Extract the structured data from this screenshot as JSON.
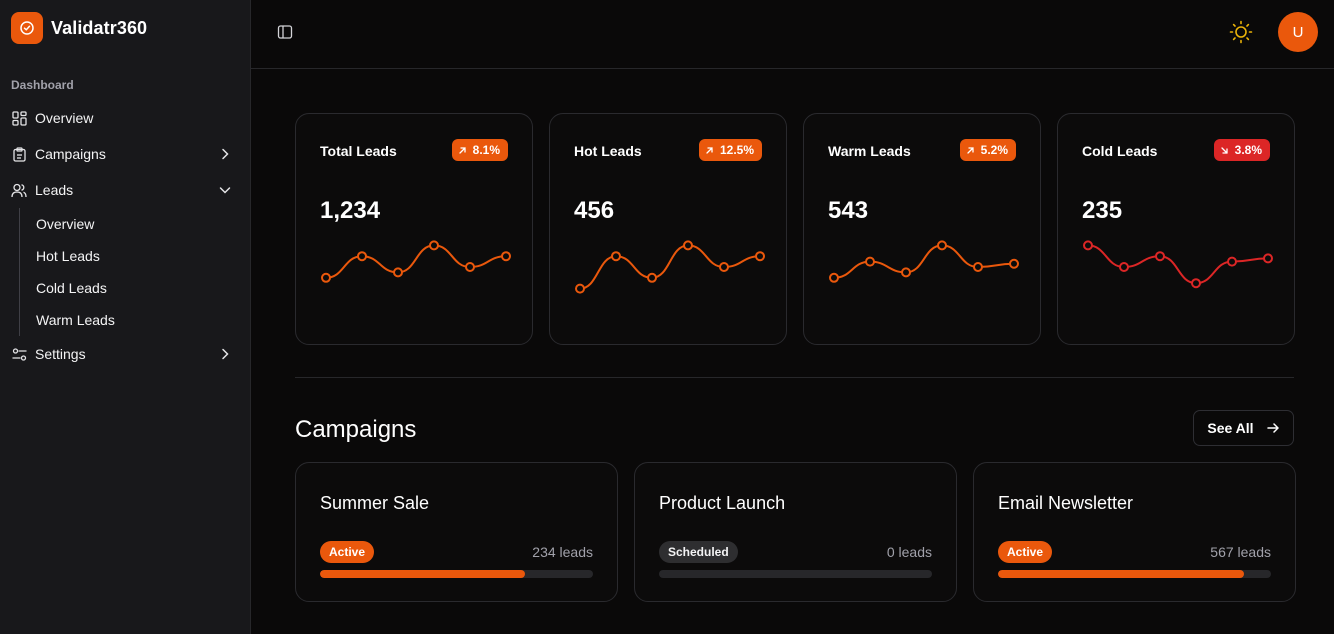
{
  "brand": {
    "name": "Validatr360"
  },
  "sidebar": {
    "section_label": "Dashboard",
    "items": [
      {
        "label": "Overview",
        "icon": "layout-grid-icon"
      },
      {
        "label": "Campaigns",
        "icon": "clipboard-icon",
        "chevron": "right"
      },
      {
        "label": "Leads",
        "icon": "users-icon",
        "chevron": "down",
        "children": [
          "Overview",
          "Hot Leads",
          "Cold Leads",
          "Warm Leads"
        ]
      },
      {
        "label": "Settings",
        "icon": "sliders-icon",
        "chevron": "right"
      }
    ]
  },
  "header": {
    "avatar_initial": "U",
    "theme_icon": "sun-icon",
    "sidebar_toggle_icon": "panel-left-icon"
  },
  "colors": {
    "accent": "#ea580c",
    "danger": "#dc2626",
    "sun": "#eab308"
  },
  "stats": [
    {
      "title": "Total Leads",
      "value": "1,234",
      "change": "8.1%",
      "trend": "up",
      "spark": [
        3,
        5,
        3.5,
        6,
        4,
        5
      ]
    },
    {
      "title": "Hot Leads",
      "value": "456",
      "change": "12.5%",
      "trend": "up",
      "spark": [
        2,
        5,
        3,
        6,
        4,
        5
      ]
    },
    {
      "title": "Warm Leads",
      "value": "543",
      "change": "5.2%",
      "trend": "up",
      "spark": [
        3,
        4.5,
        3.5,
        6,
        4,
        4.3
      ]
    },
    {
      "title": "Cold Leads",
      "value": "235",
      "change": "3.8%",
      "trend": "down",
      "spark": [
        6,
        4,
        5,
        2.5,
        4.5,
        4.8
      ]
    }
  ],
  "campaigns": {
    "title": "Campaigns",
    "see_all_label": "See All",
    "items": [
      {
        "name": "Summer Sale",
        "status": "Active",
        "status_type": "active",
        "leads": "234 leads",
        "progress": 0.75
      },
      {
        "name": "Product Launch",
        "status": "Scheduled",
        "status_type": "scheduled",
        "leads": "0 leads",
        "progress": 0
      },
      {
        "name": "Email Newsletter",
        "status": "Active",
        "status_type": "active",
        "leads": "567 leads",
        "progress": 0.9
      }
    ]
  }
}
